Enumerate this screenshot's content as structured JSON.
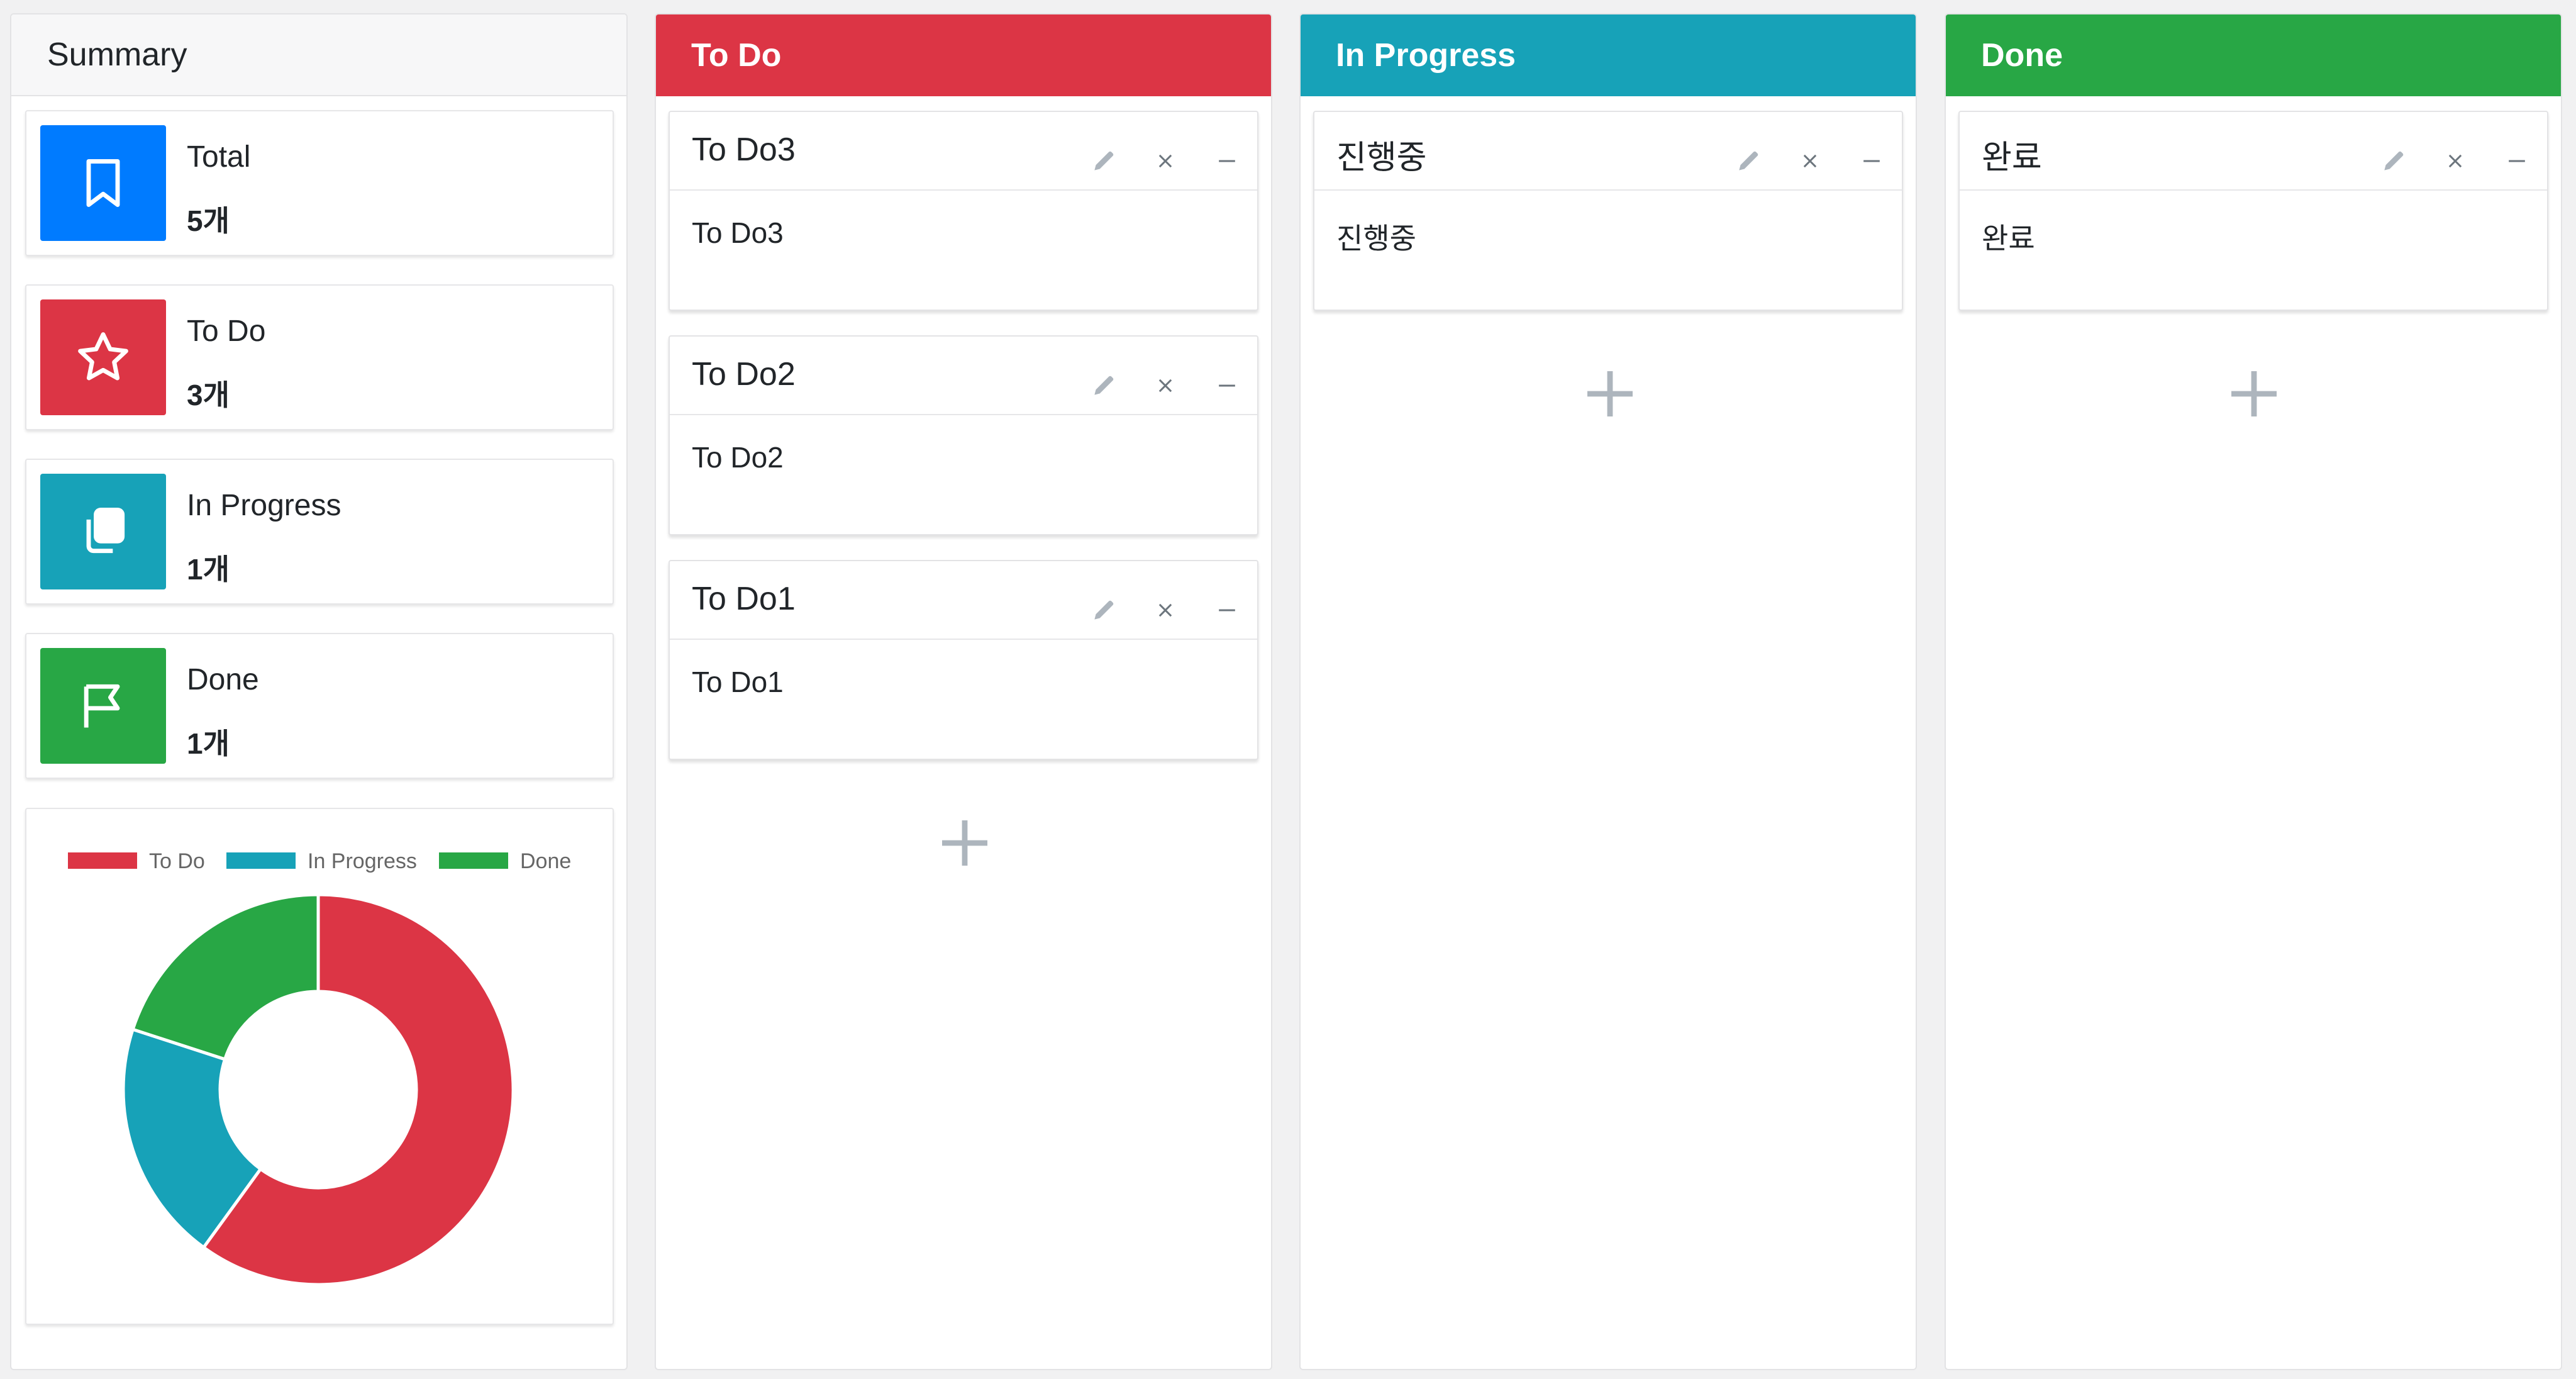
{
  "colors": {
    "todo": "#dc3545",
    "in_progress": "#17a2b8",
    "done": "#28a745",
    "total": "#007bff"
  },
  "summary": {
    "title": "Summary",
    "stats": [
      {
        "label": "Total",
        "count": "5개",
        "icon": "bookmark-icon"
      },
      {
        "label": "To Do",
        "count": "3개",
        "icon": "star-icon"
      },
      {
        "label": "In Progress",
        "count": "1개",
        "icon": "copy-icon"
      },
      {
        "label": "Done",
        "count": "1개",
        "icon": "flag-icon"
      }
    ]
  },
  "chart_data": {
    "type": "pie",
    "variant": "doughnut",
    "categories": [
      "To Do",
      "In Progress",
      "Done"
    ],
    "values": [
      3,
      1,
      1
    ],
    "colors": [
      "#dc3545",
      "#17a2b8",
      "#28a745"
    ],
    "legend": "top"
  },
  "columns": {
    "todo": {
      "title": "To Do",
      "cards": [
        {
          "title": "To Do3",
          "body": "To Do3"
        },
        {
          "title": "To Do2",
          "body": "To Do2"
        },
        {
          "title": "To Do1",
          "body": "To Do1"
        }
      ]
    },
    "in_progress": {
      "title": "In Progress",
      "cards": [
        {
          "title": "진행중",
          "body": "진행중"
        }
      ]
    },
    "done": {
      "title": "Done",
      "cards": [
        {
          "title": "완료",
          "body": "완료"
        }
      ]
    }
  }
}
